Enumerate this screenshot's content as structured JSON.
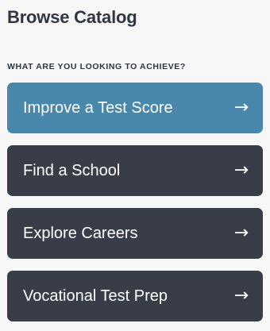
{
  "page": {
    "title": "Browse Catalog",
    "section_label": "WHAT ARE YOU LOOKING TO ACHIEVE?"
  },
  "options": [
    {
      "label": "Improve a Test Score",
      "arrow": "→",
      "style": "primary"
    },
    {
      "label": "Find a School",
      "arrow": "→",
      "style": "dark"
    },
    {
      "label": "Explore Careers",
      "arrow": "→",
      "style": "dark"
    },
    {
      "label": "Vocational Test Prep",
      "arrow": "→",
      "style": "dark"
    }
  ],
  "colors": {
    "primary": "#4a88ab",
    "dark": "#393d47",
    "text": "#2f3541",
    "background": "#f7f7f8"
  },
  "icons": {
    "arrow": "arrow-right-icon"
  }
}
